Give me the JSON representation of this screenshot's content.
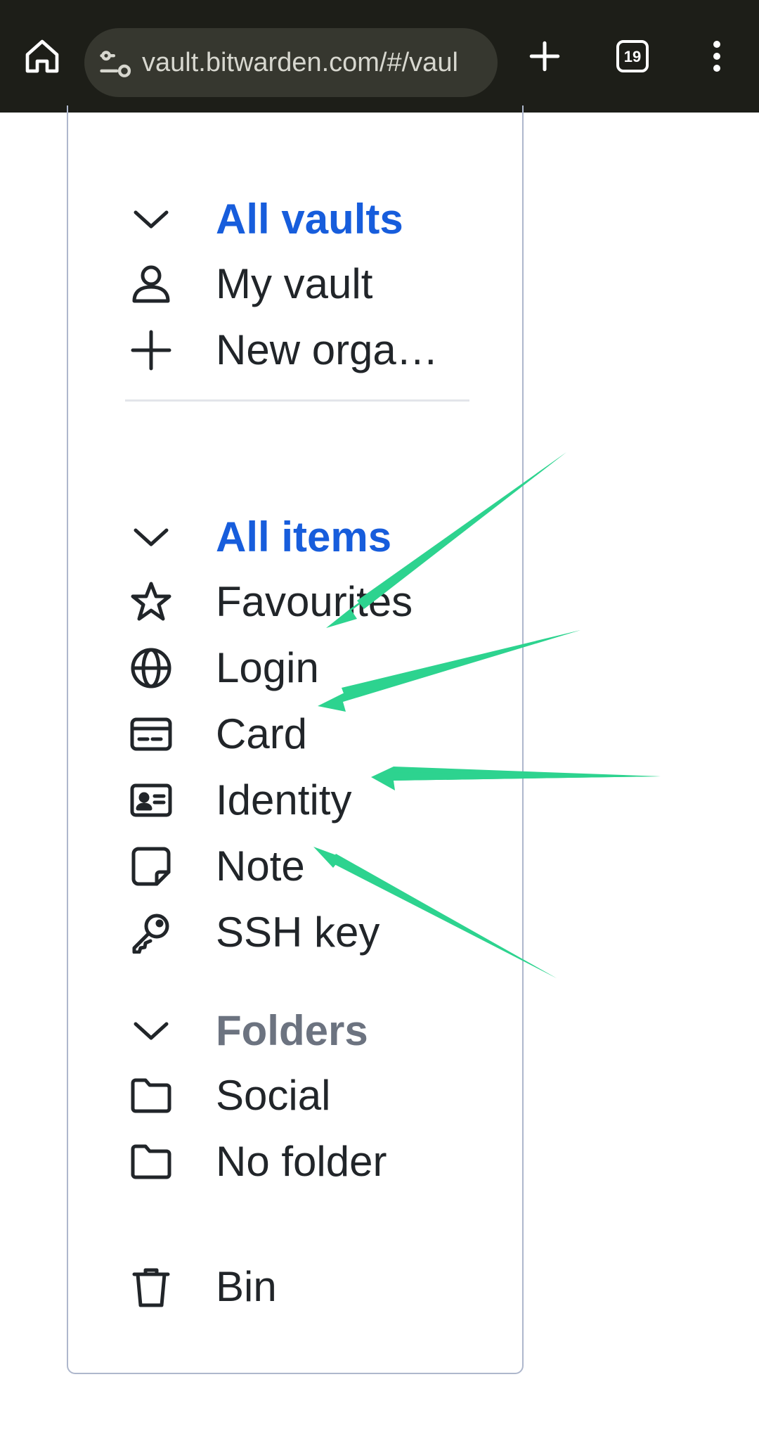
{
  "browser": {
    "url": "vault.bitwarden.com/#/vaul",
    "tab_count": "19"
  },
  "vaults": {
    "heading": "All vaults",
    "items": [
      {
        "label": "My vault",
        "icon": "user-icon"
      },
      {
        "label": "New orga…",
        "icon": "plus-icon"
      }
    ]
  },
  "types": {
    "heading": "All items",
    "items": [
      {
        "label": "Favourites",
        "icon": "star-icon"
      },
      {
        "label": "Login",
        "icon": "globe-icon"
      },
      {
        "label": "Card",
        "icon": "credit-card-icon"
      },
      {
        "label": "Identity",
        "icon": "id-card-icon"
      },
      {
        "label": "Note",
        "icon": "sticky-note-icon"
      },
      {
        "label": "SSH key",
        "icon": "key-icon"
      }
    ]
  },
  "folders": {
    "heading": "Folders",
    "items": [
      {
        "label": "Social",
        "icon": "folder-icon"
      },
      {
        "label": "No folder",
        "icon": "folder-icon"
      }
    ]
  },
  "bin": {
    "label": "Bin",
    "icon": "trash-icon"
  },
  "colors": {
    "accent_blue": "#175ddc",
    "heading_grey": "#6c7380",
    "annotation_arrow": "#2dd38f",
    "browser_bar": "#1d1e18"
  }
}
